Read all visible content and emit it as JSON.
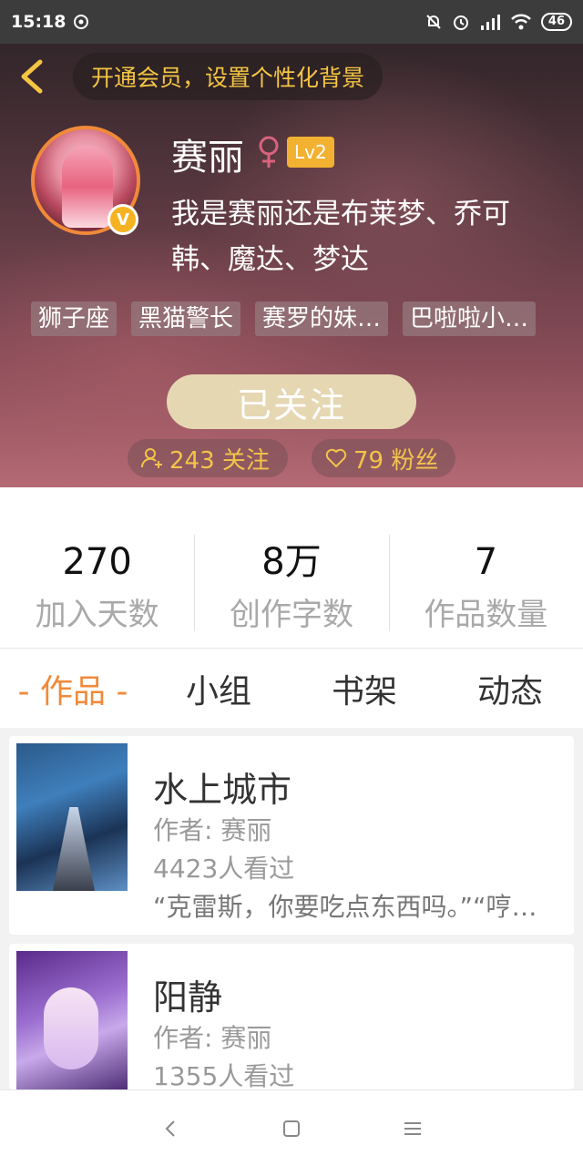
{
  "status_bar": {
    "time": "15:18",
    "battery": "46"
  },
  "top_bar": {
    "vip_prompt": "开通会员，设置个性化背景"
  },
  "profile": {
    "name": "赛丽",
    "level": "Lv2",
    "verified_badge": "V",
    "bio": "我是赛丽还是布莱梦、乔可韩、魔达、梦达",
    "tags": [
      "狮子座",
      "黑猫警长",
      "赛罗的妹…",
      "巴啦啦小…"
    ],
    "follow_button": "已关注",
    "following": "243 关注",
    "fans": "79 粉丝"
  },
  "stats": [
    {
      "num": "270",
      "label": "加入天数"
    },
    {
      "num": "8万",
      "label": "创作字数"
    },
    {
      "num": "7",
      "label": "作品数量"
    }
  ],
  "tabs": [
    "- 作品 -",
    "小组",
    "书架",
    "动态"
  ],
  "works": [
    {
      "title": "水上城市",
      "author": "作者: 赛丽",
      "views": "4423人看过",
      "excerpt": "“克雷斯，你要吃点东西吗。”“哼…"
    },
    {
      "title": "阳静",
      "author": "作者: 赛丽",
      "views": "1355人看过"
    }
  ],
  "colors": {
    "accent": "#f08a3a",
    "gold": "#f5c543",
    "level": "#f2b131",
    "follow_btn": "#e6d7b3"
  },
  "icons": [
    "back-arrow-icon",
    "female-icon",
    "add-user-icon",
    "heart-icon",
    "nav-back-icon",
    "nav-home-icon",
    "nav-menu-icon"
  ]
}
